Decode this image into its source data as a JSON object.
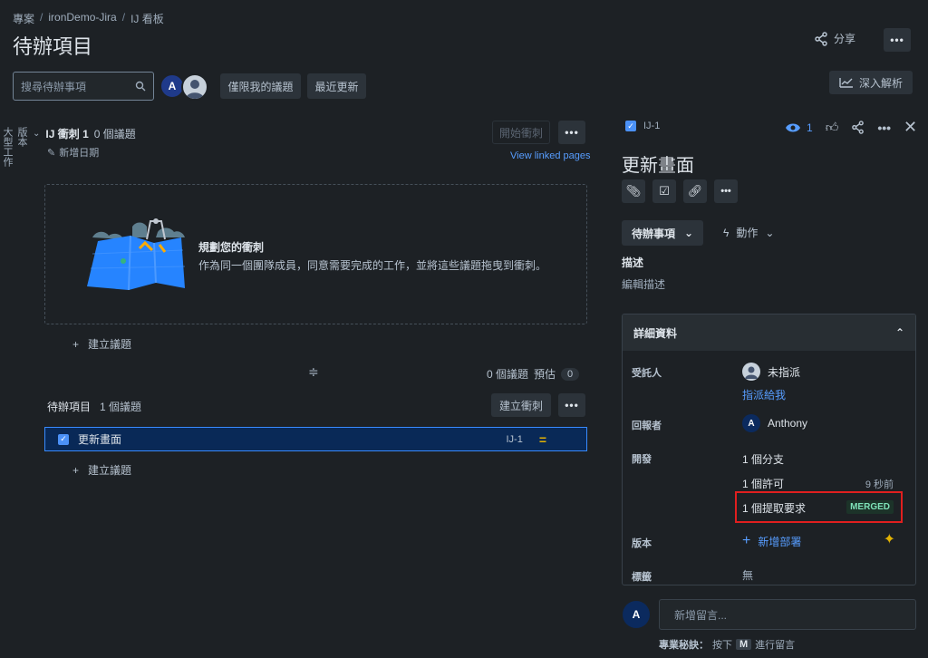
{
  "breadcrumb": [
    "專案",
    "ironDemo-Jira",
    "IJ 看板"
  ],
  "page_title": "待辦項目",
  "header": {
    "share_label": "分享",
    "more_label": "•••"
  },
  "toolbar": {
    "search_placeholder": "搜尋待辦事項",
    "avatar_initial": "A",
    "only_my_issues": "僅限我的議題",
    "recently_updated": "最近更新",
    "insights": "深入解析"
  },
  "left_rail": {
    "items": [
      "版本",
      "大型工作"
    ]
  },
  "sprint": {
    "name": "IJ 衝刺 1",
    "count": "0 個議題",
    "add_date": "新增日期",
    "start_button": "開始衝刺",
    "linked_pages": "View linked pages",
    "empty_title": "規劃您的衝刺",
    "empty_text": "作為同一個團隊成員，同意需要完成的工作，並將這些議題拖曳到衝刺。",
    "create_issue": "建立議題",
    "summary_count": "0 個議題",
    "estimate_label": "預估",
    "estimate_value": "0"
  },
  "backlog": {
    "title": "待辦項目",
    "count": "1 個議題",
    "create_sprint": "建立衝刺",
    "create_issue": "建立議題",
    "issues": [
      {
        "summary": "更新畫面",
        "key": "IJ-1",
        "priority": "="
      }
    ]
  },
  "detail": {
    "key": "IJ-1",
    "watch_count": "1",
    "title": "更新畫面",
    "status": "待辦事項",
    "actions": "動作",
    "description_label": "描述",
    "description_placeholder": "編輯描述",
    "details_title": "詳細資料",
    "fields": {
      "assignee_label": "受託人",
      "assignee_value": "未指派",
      "assign_to_me": "指派給我",
      "reporter_label": "回報者",
      "reporter_initial": "A",
      "reporter_value": "Anthony",
      "development_label": "開發",
      "branch": "1 個分支",
      "commit": "1 個許可",
      "commit_time": "9 秒前",
      "pull_request": "1 個提取要求",
      "pr_status": "MERGED",
      "version_label": "版本",
      "add_deployment": "新增部署",
      "labels_label": "標籤",
      "labels_value": "無"
    },
    "comment_avatar": "A",
    "comment_placeholder": "新增留言...",
    "tip_prefix": "專業秘訣：",
    "tip_press": "按下",
    "tip_key": "M",
    "tip_suffix": "進行留言"
  },
  "colors": {
    "accent": "#579dff",
    "highlight_row": "#092957",
    "merged": "#7ee2b8",
    "annotation": "#e01f1f"
  }
}
